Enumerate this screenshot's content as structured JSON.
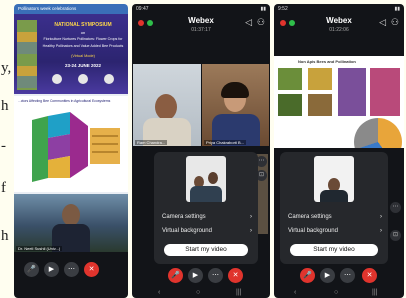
{
  "doc_letters": [
    "y,",
    "h",
    "-",
    "f",
    "h"
  ],
  "phone1": {
    "banner_top": "Pollinators week celebrations",
    "symposium_title": "NATIONAL SYMPOSIUM",
    "symposium_on": "on",
    "symposium_line1": "Floriculture Nurtures Pollinators: Flower Crops for",
    "symposium_line2": "Healthy Pollinators and Value Added Bee Products",
    "symposium_venue": "(Virtual Mode)",
    "symposium_dates": "23-24 JUNE 2022",
    "slide_title": "...ctors Affecting Bee Communities in Agricultural Ecosystems",
    "speaker_label": "Dr. Neeli Sushil (Univ...)"
  },
  "phone2": {
    "time": "09:47",
    "title": "Webex",
    "timer": "01:37:17",
    "tile1_label": "Ram Chandra...",
    "tile2_label": "Priya Chakraborti B...",
    "camera_settings": "Camera settings",
    "virtual_background": "Virtual background",
    "start_video": "Start my video"
  },
  "phone3": {
    "time": "9:52",
    "title": "Webex",
    "timer": "01:22:06",
    "slide_title": "Non Apis Bees and Pollination",
    "camera_settings": "Camera settings",
    "virtual_background": "Virtual background",
    "start_video": "Start my video"
  },
  "colors": {
    "end_call": "#e0342d",
    "bg": "#121418"
  }
}
